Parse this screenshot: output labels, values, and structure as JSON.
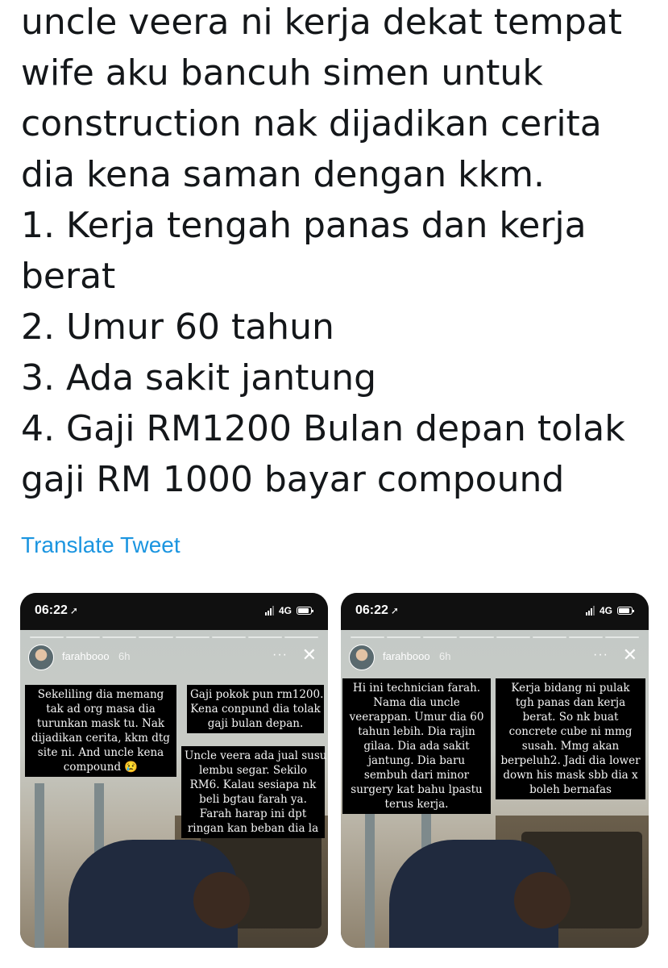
{
  "tweet": {
    "lines": [
      "uncle veera ni kerja dekat tempat",
      "wife aku bancuh simen untuk",
      "construction nak dijadikan cerita",
      "dia kena saman dengan kkm.",
      "1. Kerja tengah panas dan kerja",
      "berat",
      "2. Umur 60 tahun",
      "3. Ada sakit jantung",
      "4. Gaji RM1200 Bulan depan tolak",
      "gaji RM 1000 bayar compound"
    ],
    "translate_label": "Translate Tweet"
  },
  "colors": {
    "text": "#14171a",
    "link": "#1b95e0",
    "caption_bg": "#000000"
  },
  "stories": [
    {
      "time": "06:22",
      "network": "4G",
      "username": "farahbooo",
      "age": "6h",
      "captions": [
        [
          "Sekeliling dia memang",
          "tak ad org masa dia",
          "turunkan mask tu. Nak",
          "dijadikan cerita, kkm dtg",
          "site ni. And uncle kena",
          "compound 😢"
        ],
        [
          "Gaji pokok pun rm1200.",
          "Kena conpund dia tolak",
          "gaji bulan depan."
        ],
        [
          "Uncle veera ada jual susu",
          "lembu segar. Sekilo",
          "RM6. Kalau sesiapa nk",
          "beli bgtau farah ya.",
          "Farah harap ini dpt",
          "ringan kan beban dia la"
        ]
      ]
    },
    {
      "time": "06:22",
      "network": "4G",
      "username": "farahbooo",
      "age": "6h",
      "captions": [
        [
          "Hi ini technician farah.",
          "Nama dia uncle",
          "veerappan. Umur dia 60",
          "tahun lebih. Dia rajin",
          "gilaa. Dia ada sakit",
          "jantung. Dia baru",
          "sembuh dari minor",
          "surgery kat bahu lpastu",
          "terus kerja."
        ],
        [
          "Kerja bidang ni pulak",
          "tgh panas dan kerja",
          "berat. So nk buat",
          "concrete cube ni mmg",
          "susah. Mmg akan",
          "berpeluh2. Jadi dia lower",
          "down his mask sbb dia x",
          "boleh bernafas"
        ]
      ]
    }
  ],
  "icons": [
    "location-arrow-icon",
    "signal-icon",
    "battery-icon",
    "more-icon",
    "close-icon"
  ]
}
